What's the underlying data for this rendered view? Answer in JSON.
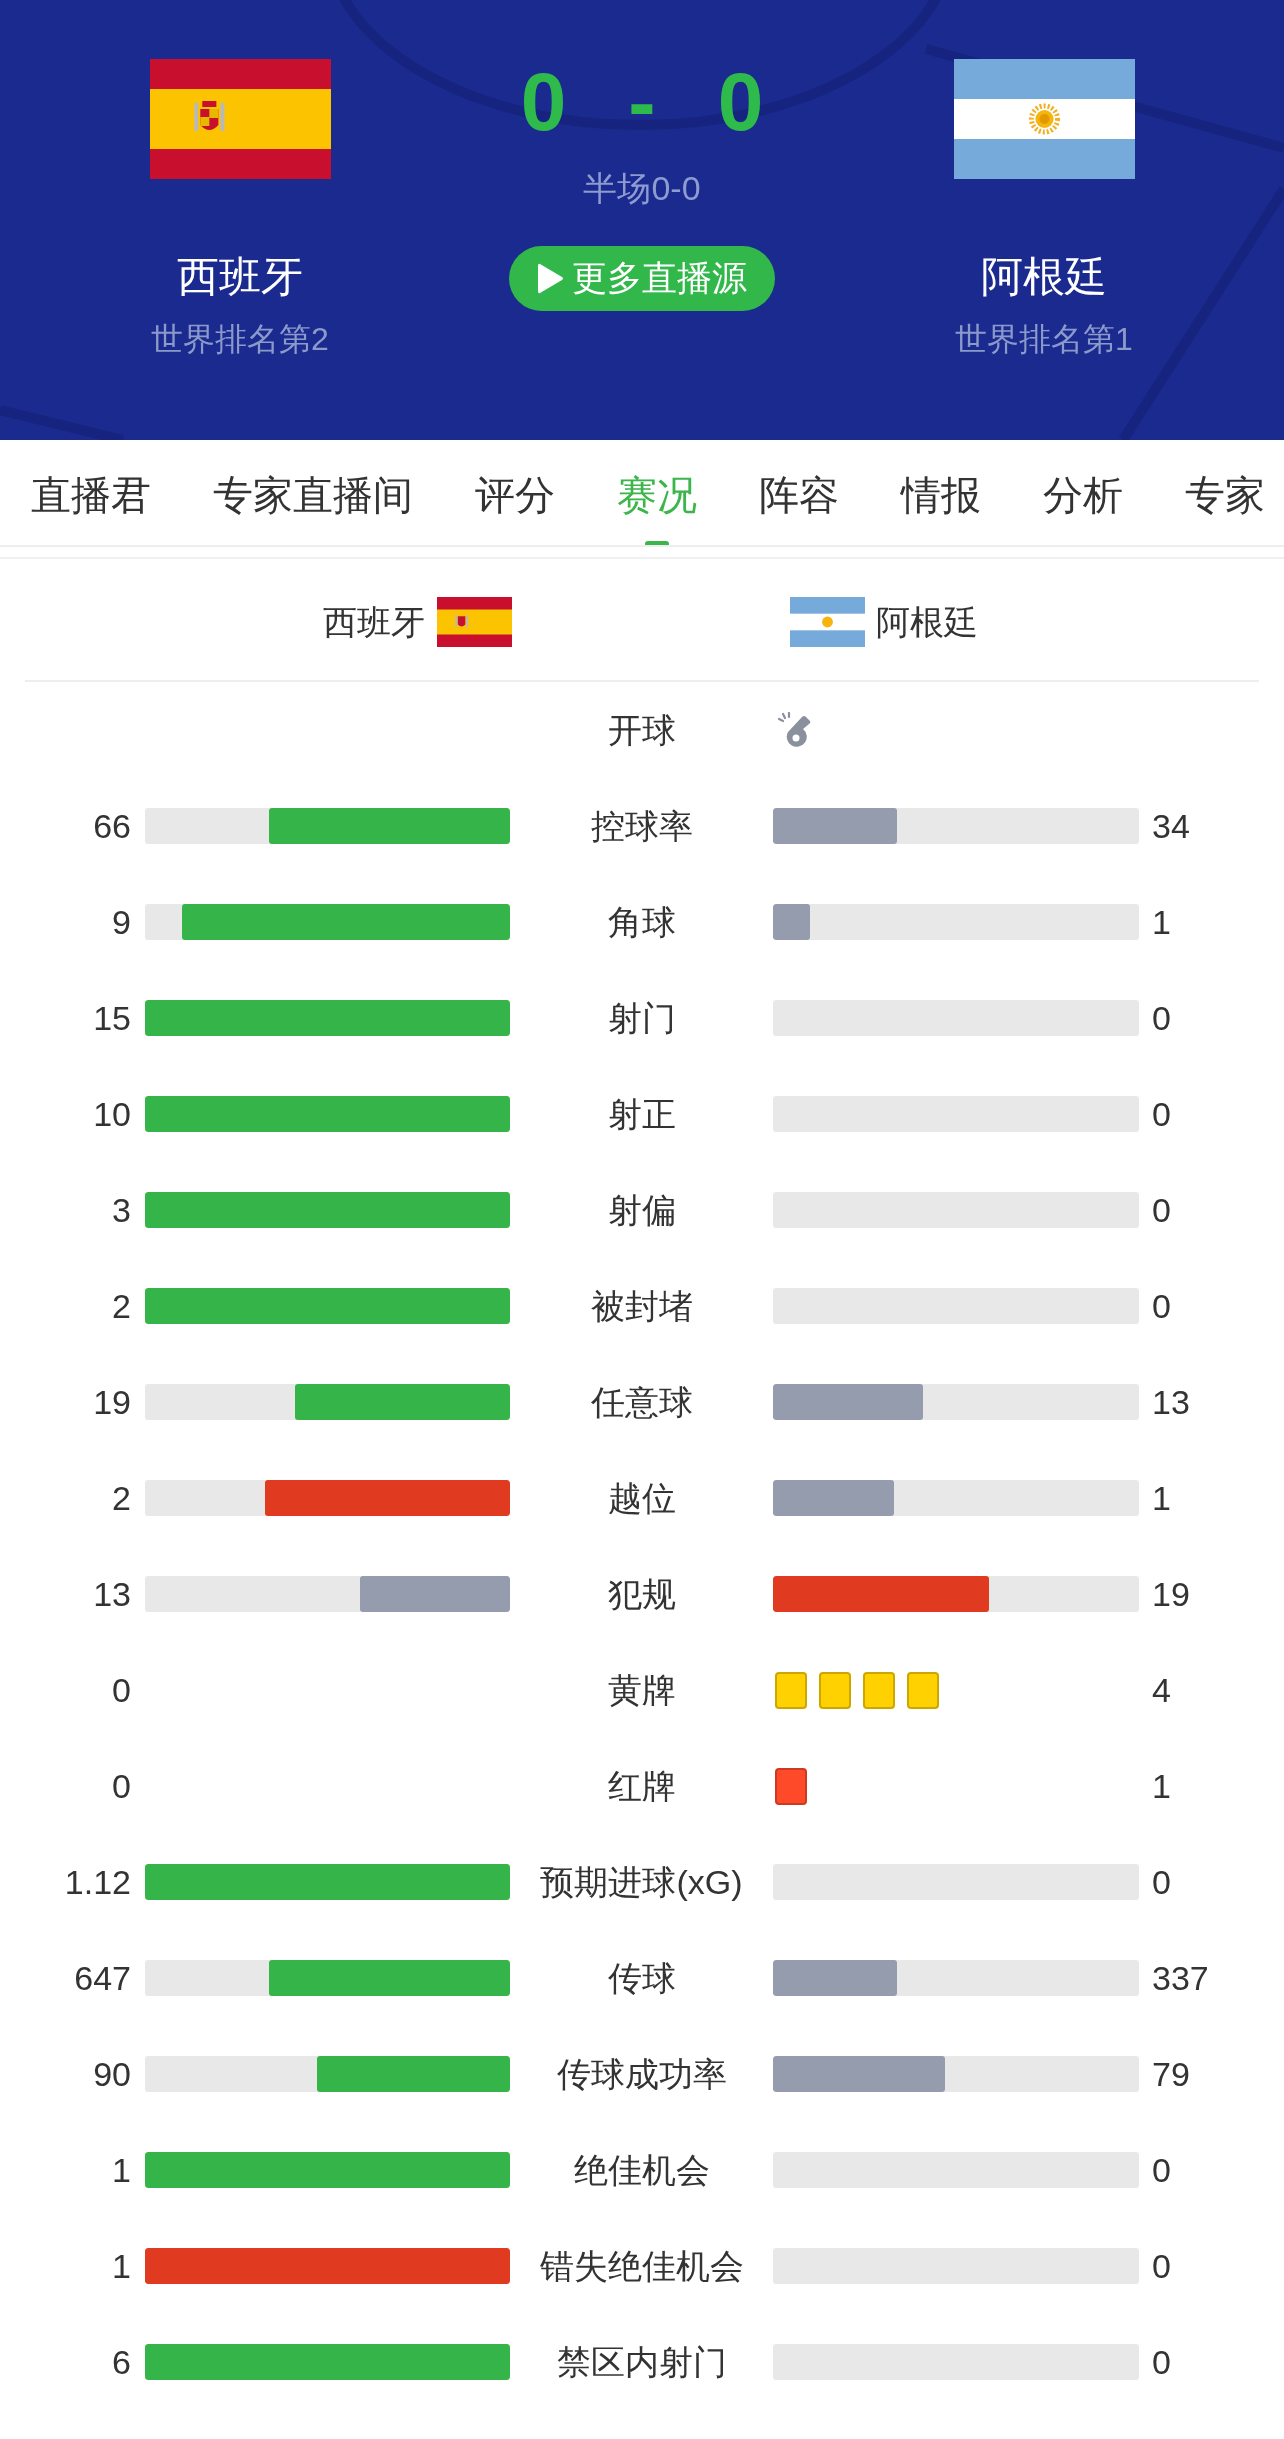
{
  "header": {
    "home": {
      "name": "西班牙",
      "rank": "世界排名第2"
    },
    "away": {
      "name": "阿根廷",
      "rank": "世界排名第1"
    },
    "score": {
      "home": "0",
      "separator": "-",
      "away": "0"
    },
    "half_time": "半场0-0",
    "live_button": "更多直播源"
  },
  "tabs": [
    {
      "label": "直播君",
      "selected": false
    },
    {
      "label": "专家直播间",
      "selected": false
    },
    {
      "label": "评分",
      "selected": false
    },
    {
      "label": "赛况",
      "selected": true
    },
    {
      "label": "阵容",
      "selected": false
    },
    {
      "label": "情报",
      "selected": false
    },
    {
      "label": "分析",
      "selected": false
    },
    {
      "label": "专家",
      "selected": false
    }
  ],
  "stats_header": {
    "home": "西班牙",
    "away": "阿根廷"
  },
  "stats": [
    {
      "kind": "kickoff",
      "label": "开球",
      "home_kickoff": false,
      "away_kickoff": true
    },
    {
      "kind": "bar",
      "label": "控球率",
      "home": {
        "value": "66",
        "level": 0.66,
        "color": "#35b449"
      },
      "away": {
        "value": "34",
        "level": 0.34,
        "color": "#949cad"
      }
    },
    {
      "kind": "bar",
      "label": "角球",
      "home": {
        "value": "9",
        "level": 0.9,
        "color": "#35b449"
      },
      "away": {
        "value": "1",
        "level": 0.1,
        "color": "#949cad"
      }
    },
    {
      "kind": "bar",
      "label": "射门",
      "home": {
        "value": "15",
        "level": 1,
        "color": "#35b449"
      },
      "away": {
        "value": "0"
      }
    },
    {
      "kind": "bar",
      "label": "射正",
      "home": {
        "value": "10",
        "level": 1,
        "color": "#35b449"
      },
      "away": {
        "value": "0"
      }
    },
    {
      "kind": "bar",
      "label": "射偏",
      "home": {
        "value": "3",
        "level": 1,
        "color": "#35b449"
      },
      "away": {
        "value": "0"
      }
    },
    {
      "kind": "bar",
      "label": "被封堵",
      "home": {
        "value": "2",
        "level": 1,
        "color": "#35b449"
      },
      "away": {
        "value": "0"
      }
    },
    {
      "kind": "bar",
      "label": "任意球",
      "home": {
        "value": "19",
        "level": 0.59,
        "color": "#35b449"
      },
      "away": {
        "value": "13",
        "level": 0.41,
        "color": "#949cad"
      }
    },
    {
      "kind": "bar",
      "label": "越位",
      "home": {
        "value": "2",
        "level": 0.67,
        "color": "#e03b20"
      },
      "away": {
        "value": "1",
        "level": 0.33,
        "color": "#949cad"
      }
    },
    {
      "kind": "bar",
      "label": "犯规",
      "home": {
        "value": "13",
        "level": 0.41,
        "color": "#949cad"
      },
      "away": {
        "value": "19",
        "level": 0.59,
        "color": "#e03b20"
      }
    },
    {
      "kind": "cards",
      "label": "黄牌",
      "home": {
        "value": "0"
      },
      "away": {
        "value": "4",
        "cards": [
          {
            "color": "#ffd100"
          },
          {
            "color": "#ffd100"
          },
          {
            "color": "#ffd100"
          },
          {
            "color": "#ffd100"
          }
        ]
      }
    },
    {
      "kind": "cards",
      "label": "红牌",
      "home": {
        "value": "0"
      },
      "away": {
        "value": "1",
        "cards": [
          {
            "color": "#ff4a2a"
          }
        ]
      }
    },
    {
      "kind": "bar",
      "label": "预期进球(xG)",
      "home": {
        "value": "1.12",
        "level": 1,
        "color": "#35b449"
      },
      "away": {
        "value": "0"
      }
    },
    {
      "kind": "bar",
      "label": "传球",
      "home": {
        "value": "647",
        "level": 0.66,
        "color": "#35b449"
      },
      "away": {
        "value": "337",
        "level": 0.34,
        "color": "#949cad"
      }
    },
    {
      "kind": "bar",
      "label": "传球成功率",
      "home": {
        "value": "90",
        "level": 0.53,
        "color": "#35b449"
      },
      "away": {
        "value": "79",
        "level": 0.47,
        "color": "#949cad"
      }
    },
    {
      "kind": "bar",
      "label": "绝佳机会",
      "home": {
        "value": "1",
        "level": 1,
        "color": "#35b449"
      },
      "away": {
        "value": "0"
      }
    },
    {
      "kind": "bar",
      "label": "错失绝佳机会",
      "home": {
        "value": "1",
        "level": 1,
        "color": "#e03b20"
      },
      "away": {
        "value": "0"
      }
    },
    {
      "kind": "bar",
      "label": "禁区内射门",
      "home": {
        "value": "6",
        "level": 1,
        "color": "#35b449"
      },
      "away": {
        "value": "0"
      }
    }
  ]
}
